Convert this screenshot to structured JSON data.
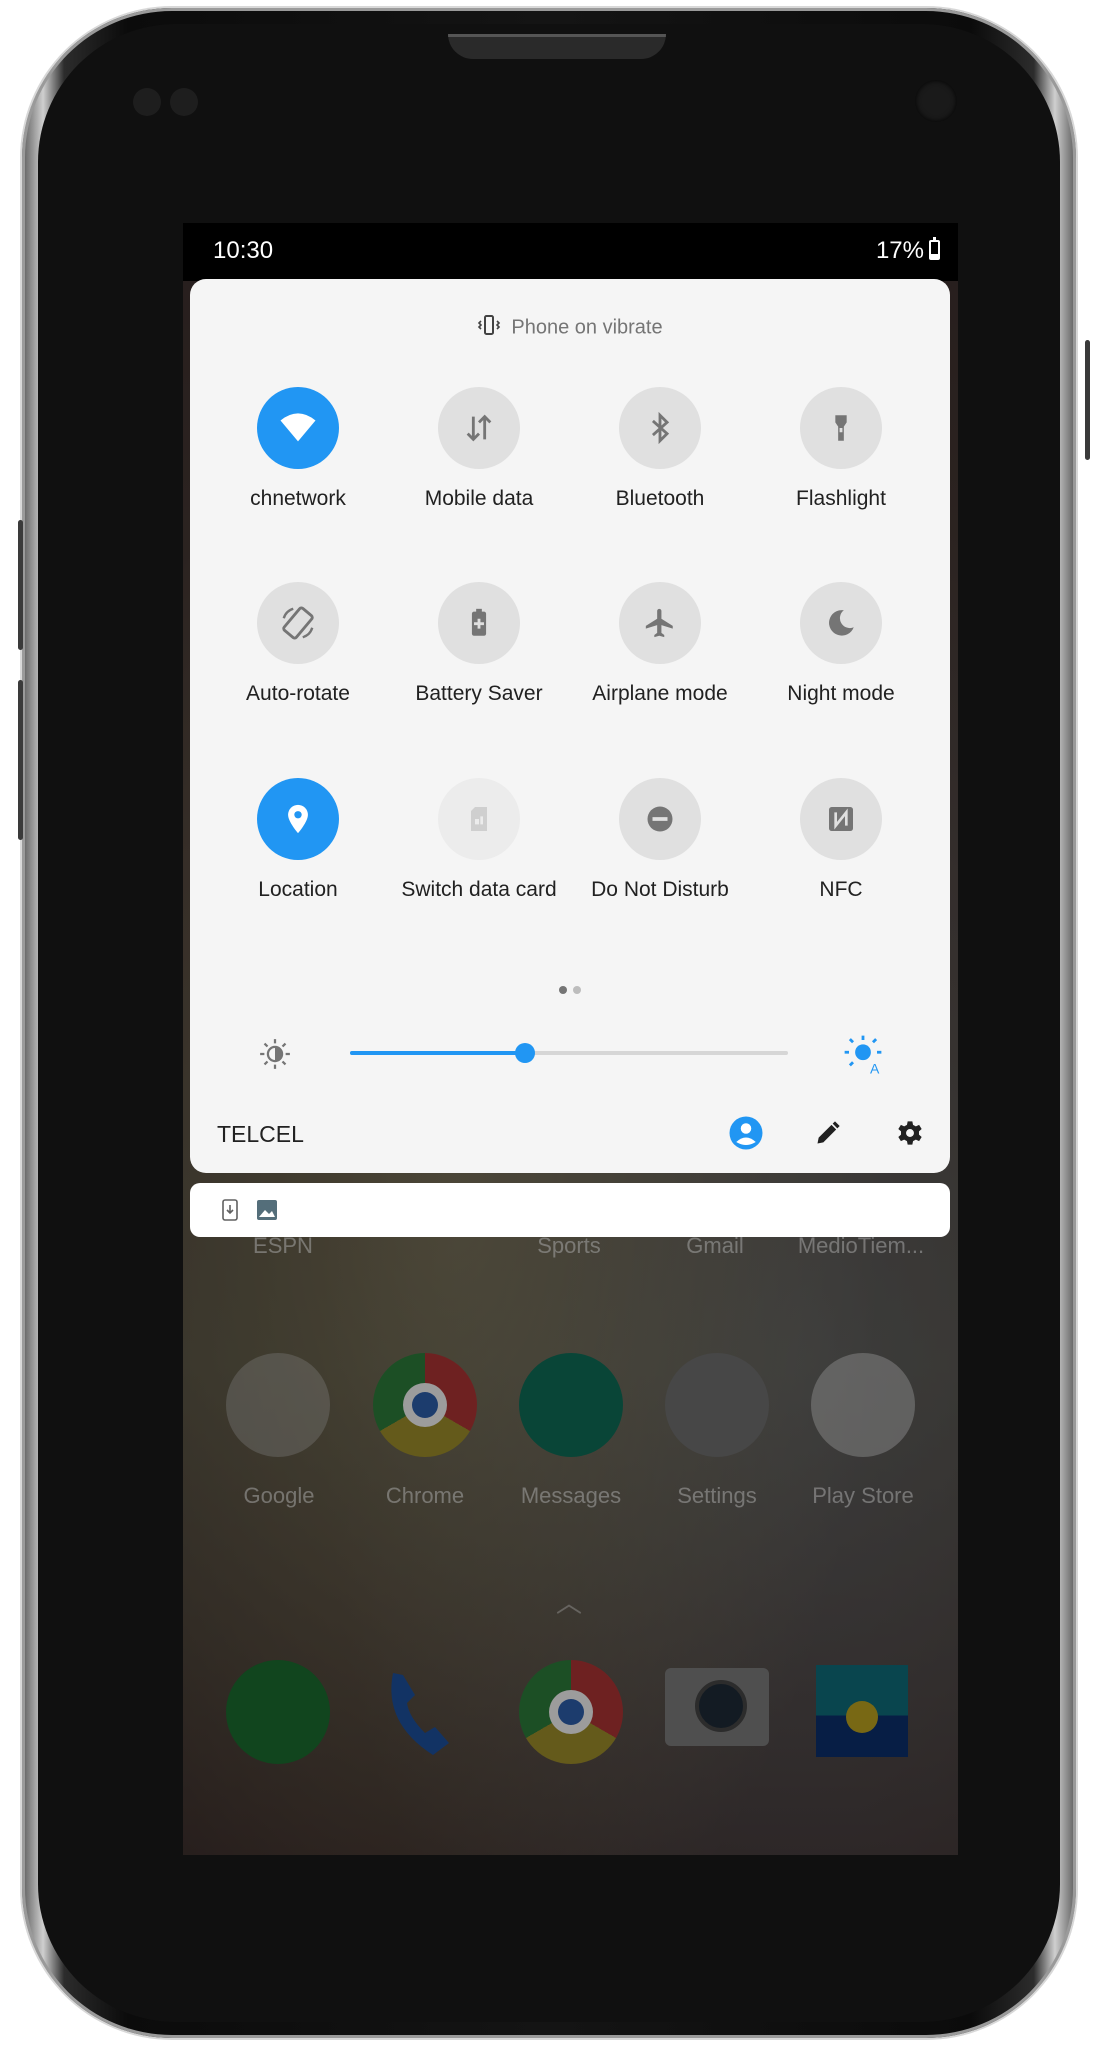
{
  "status_bar": {
    "time": "10:30",
    "battery": "17%"
  },
  "quick_settings": {
    "mode_text": "Phone on vibrate",
    "tiles": [
      {
        "label": "chnetwork",
        "icon": "wifi-icon",
        "state": "on"
      },
      {
        "label": "Mobile data",
        "icon": "mobile-data-icon",
        "state": "off"
      },
      {
        "label": "Bluetooth",
        "icon": "bluetooth-icon",
        "state": "off"
      },
      {
        "label": "Flashlight",
        "icon": "flashlight-icon",
        "state": "off"
      },
      {
        "label": "Auto-rotate",
        "icon": "auto-rotate-icon",
        "state": "off"
      },
      {
        "label": "Battery Saver",
        "icon": "battery-saver-icon",
        "state": "off"
      },
      {
        "label": "Airplane mode",
        "icon": "airplane-icon",
        "state": "off"
      },
      {
        "label": "Night mode",
        "icon": "moon-icon",
        "state": "off"
      },
      {
        "label": "Location",
        "icon": "location-pin-icon",
        "state": "on"
      },
      {
        "label": "Switch data card",
        "icon": "sim-card-icon",
        "state": "unavailable"
      },
      {
        "label": "Do Not Disturb",
        "icon": "do-not-disturb-icon",
        "state": "off"
      },
      {
        "label": "NFC",
        "icon": "nfc-icon",
        "state": "off"
      }
    ],
    "page_count": 2,
    "current_page": 1,
    "brightness_fraction": 0.4,
    "carrier": "TELCEL"
  },
  "notifications": {
    "icons": [
      "download-notification-icon",
      "image-notification-icon"
    ]
  },
  "home_screen": {
    "row1_labels": [
      "ESPN",
      "Sports",
      "Gmail",
      "MedioTiem..."
    ],
    "row2_labels": [
      "Google",
      "Chrome",
      "Messages",
      "Settings",
      "Play Store"
    ],
    "dock_apps": [
      "WhatsApp",
      "Phone",
      "Chrome",
      "Camera",
      "Gallery"
    ]
  },
  "colors": {
    "accent": "#2196f3",
    "panel": "#f5f5f5",
    "tile_off": "#e0e0e0"
  }
}
